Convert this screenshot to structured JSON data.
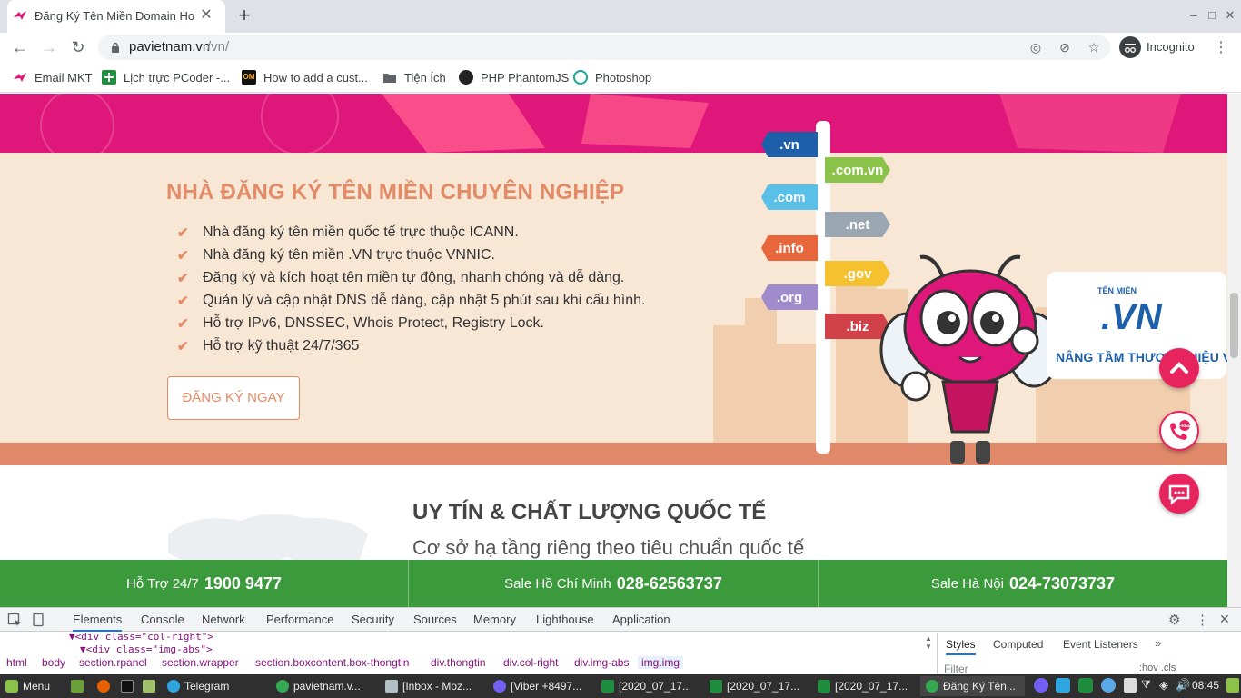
{
  "browser": {
    "tab_title": "Đăng Ký Tên Miền Domain Host",
    "url_host": "pavietnam.vn",
    "url_path": "/vn/",
    "incognito_label": "Incognito",
    "new_tab": "+",
    "bookmarks": [
      {
        "label": "Email MKT",
        "icon": "pa-logo-icon"
      },
      {
        "label": "Lịch trực PCoder -...",
        "icon": "sheet-plus-icon"
      },
      {
        "label": "How to add a cust...",
        "icon": "om-icon"
      },
      {
        "label": "Tiện Ích",
        "icon": "folder-icon"
      },
      {
        "label": "PHP PhantomJS",
        "icon": "github-icon"
      },
      {
        "label": "Photoshop",
        "icon": "photoshop-icon"
      }
    ]
  },
  "page": {
    "hero": {
      "title": "NHÀ ĐĂNG KÝ TÊN MIỀN CHUYÊN NGHIỆP",
      "features": [
        "Nhà đăng ký tên miền quốc tế trực thuộc ICANN.",
        "Nhà đăng ký tên miền .VN trực thuộc VNNIC.",
        "Đăng ký và kích hoạt tên miền tự động, nhanh chóng và dễ dàng.",
        "Quản lý và cập nhật DNS dễ dàng, cập nhật 5 phút sau khi cấu hình.",
        "Hỗ trợ IPv6, DNSSEC, Whois Protect, Registry Lock.",
        "Hỗ trợ kỹ thuật 24/7/365"
      ],
      "register_button": "ĐĂNG KÝ NGAY",
      "signs": [
        ".vn",
        ".com.vn",
        ".com",
        ".net",
        ".info",
        ".gov",
        ".org",
        ".biz"
      ],
      "sign_colors": [
        "#1d5fa8",
        "#8bc34a",
        "#5bc0e8",
        "#9aa7b3",
        "#e8663c",
        "#f5c12e",
        "#a08ccd",
        "#d0414a"
      ],
      "brand_top": "TÊN MIỀN",
      "brand_vn": ".VN",
      "brand_slogan": "NÂNG TẦM THƯƠNG HIỆU VIỆT"
    },
    "section2": {
      "title": "UY TÍN & CHẤT LƯỢNG QUỐC TẾ",
      "subtitle": "Cơ sở hạ tầng riêng theo tiêu chuẩn quốc tế"
    },
    "support": [
      {
        "label": "Hỗ Trợ 24/7",
        "number": "1900 9477"
      },
      {
        "label": "Sale Hồ Chí Minh",
        "number": "028-62563737"
      },
      {
        "label": "Sale Hà Nội",
        "number": "024-73073737"
      }
    ],
    "fab_free": "FREE"
  },
  "devtools": {
    "tabs": [
      "Elements",
      "Console",
      "Network",
      "Performance",
      "Security",
      "Sources",
      "Memory",
      "Lighthouse",
      "Application"
    ],
    "more": "»",
    "code_line1": "▼<div class=\"col-right\">",
    "code_line2": "▼<div class=\"img-abs\">",
    "breadcrumbs": [
      "html",
      "body",
      "section.rpanel",
      "section.wrapper",
      "section.boxcontent.box-thongtin",
      "div.thongtin",
      "div.col-right",
      "div.img-abs",
      "img.img"
    ],
    "styles_tabs": [
      "Styles",
      "Computed",
      "Event Listeners"
    ],
    "filter_placeholder": "Filter",
    "filter_hints": ":hov .cls"
  },
  "taskbar": {
    "menu": "Menu",
    "items": [
      "Telegram",
      "pavietnam.v...",
      "[Inbox - Moz...",
      "[Viber +8497...",
      "[2020_07_17...",
      "[2020_07_17...",
      "[2020_07_17...",
      "Đăng Ký Tên..."
    ],
    "clock": "08:45"
  }
}
